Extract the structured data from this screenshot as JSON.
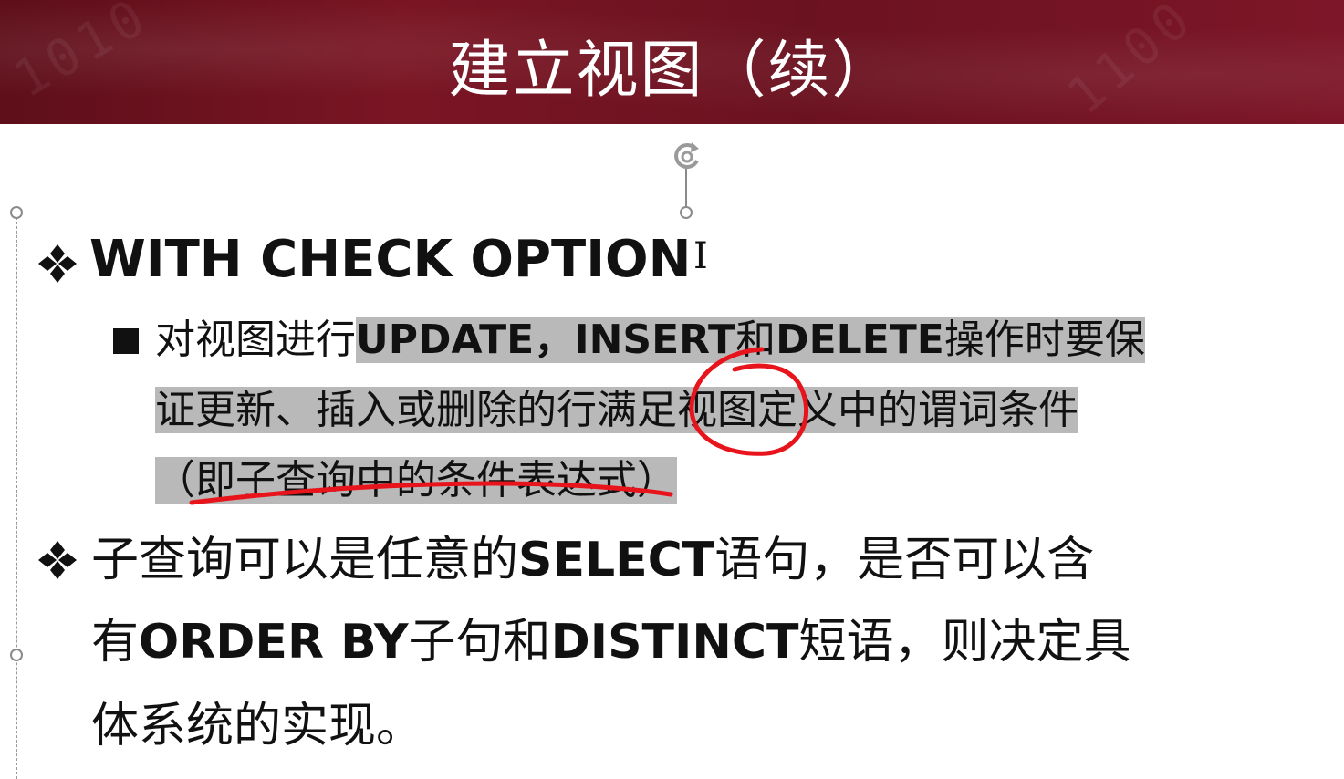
{
  "slide": {
    "title": "建立视图（续）",
    "banner_color": "#6b1220"
  },
  "bullets": {
    "item1": {
      "heading": "WITH CHECK OPTION",
      "sub": {
        "line1_plain": "对视图进行",
        "line1_hl_a": "UPDATE，INSERT",
        "line1_hl_b": "和",
        "line1_hl_c": "DELETE",
        "line1_hl_d": "操作时要保",
        "line2": "证更新、插入或删除的行满足视图定义中的谓词条件",
        "line3": "（即子查询中的条件表达式）"
      }
    },
    "item2": {
      "line1_a": "子查询可以是任意的",
      "line1_b": "SELECT",
      "line1_c": "语句，是否可以含",
      "line2_a": "有",
      "line2_b": "ORDER BY",
      "line2_c": "子句和",
      "line2_d": "DISTINCT",
      "line2_e": "短语，则决定具",
      "line3": "体系统的实现。"
    }
  },
  "icons": {
    "bullet": "four-diamond-bullet-icon",
    "rotate": "rotate-handle-icon",
    "cursor": "text-cursor-icon"
  },
  "annotation_color": "#e8141c",
  "highlight_color": "#b9b9b9"
}
